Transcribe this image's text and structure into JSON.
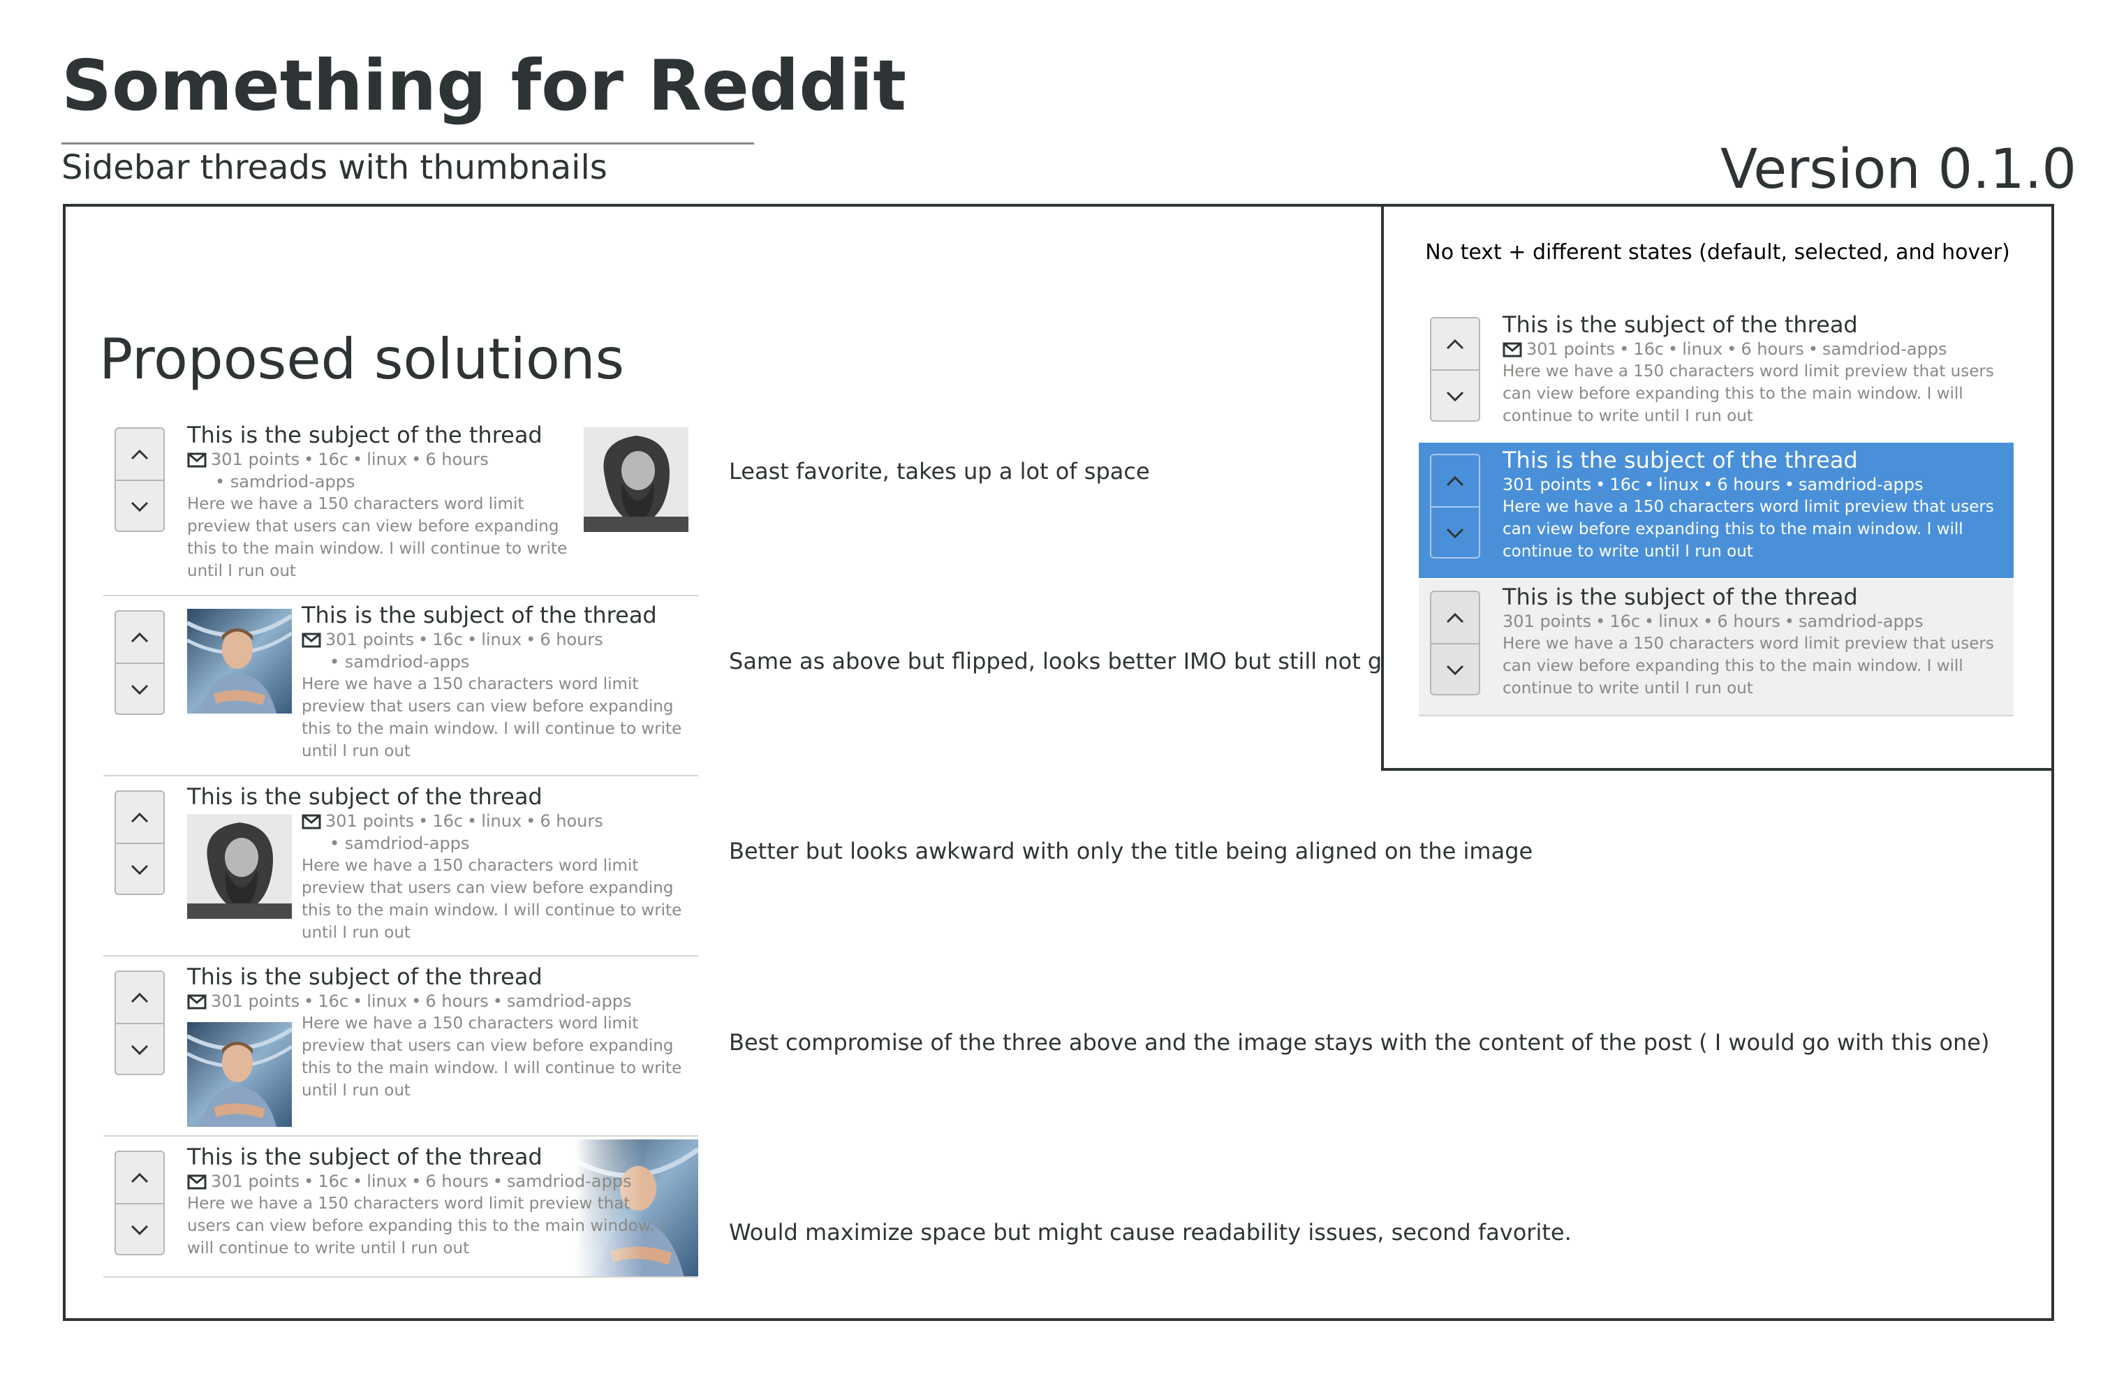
{
  "header": {
    "title": "Something for Reddit",
    "subtitle": "Sidebar threads with thumbnails",
    "version": "Version 0.1.0"
  },
  "proposed": {
    "heading": "Proposed solutions"
  },
  "states_panel": {
    "caption": "No text + different states (default, selected, and hover)"
  },
  "thread": {
    "title": "This is the subject of the thread",
    "points": "301 points",
    "comments": "16c",
    "subreddit": "linux",
    "age": "6 hours",
    "author": "samdriod-apps",
    "dot": "•",
    "preview": "Here we have a 150 characters word limit preview that users can view before expanding this to the main window. I will continue to write until I run out"
  },
  "descriptions": [
    "Least favorite, takes up a lot of space",
    "Same as above but flipped, looks better IMO but still not good",
    "Better but looks awkward with only the title being aligned on the image",
    "Best compromise of the three above and the image stays with the content of the post ( I would go with this one)",
    "Would maximize space but might cause readability issues, second favorite."
  ],
  "icons": {
    "upvote": "chevron-up-icon",
    "downvote": "chevron-down-icon",
    "message": "envelope-icon",
    "thumbnail_a": "bearded-man-photo",
    "thumbnail_b": "man-crossed-arms-photo"
  },
  "colors": {
    "selected_bg": "#4a90d9",
    "hover_bg": "#f0f0f0",
    "meta_text": "#888a85",
    "frame": "#2e3436"
  }
}
